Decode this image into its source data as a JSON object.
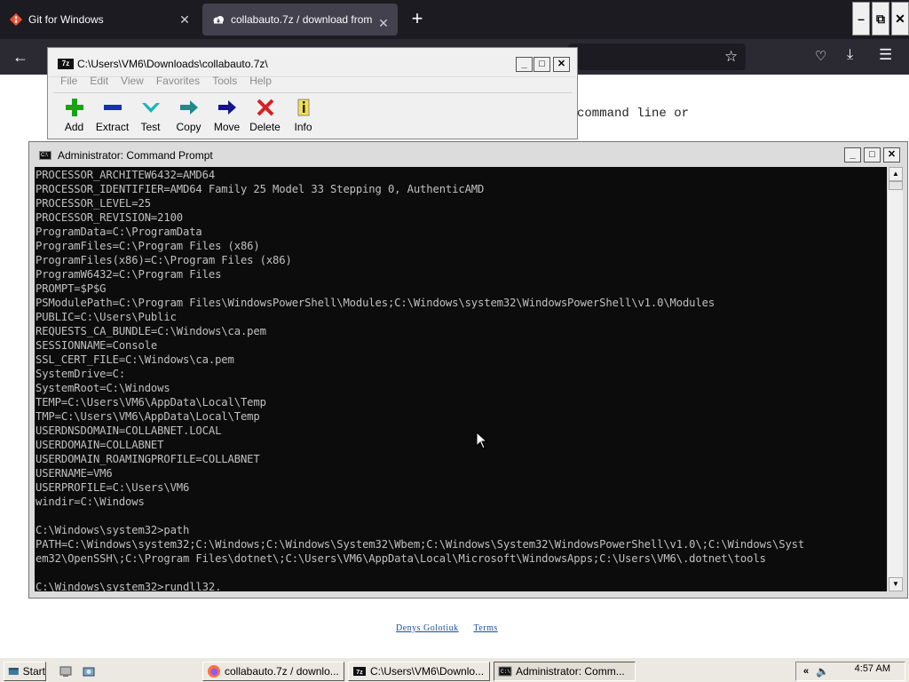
{
  "browser": {
    "tabs": [
      {
        "label": "Git for Windows"
      },
      {
        "label": "collabauto.7z / download from"
      }
    ],
    "colors": {
      "tabstrip": "#1c1b22",
      "active_tab": "#42414d",
      "navbar": "#2b2a33"
    }
  },
  "webpage": {
    "visible_text": "command line or",
    "footer_links": [
      "Denys Golotiuk",
      "Terms"
    ]
  },
  "zip_window": {
    "title": "C:\\Users\\VM6\\Downloads\\collabauto.7z\\",
    "app_icon_text": "7z",
    "menu": [
      "File",
      "Edit",
      "View",
      "Favorites",
      "Tools",
      "Help"
    ],
    "toolbar": [
      {
        "label": "Add",
        "icon": "plus-icon",
        "color": "#1aa31a"
      },
      {
        "label": "Extract",
        "icon": "minus-icon",
        "color": "#1a2fb8"
      },
      {
        "label": "Test",
        "icon": "check-icon",
        "color": "#18b6b6"
      },
      {
        "label": "Copy",
        "icon": "arrow-right-icon",
        "color": "#1f8a8a"
      },
      {
        "label": "Move",
        "icon": "arrow-right-icon",
        "color": "#14148c"
      },
      {
        "label": "Delete",
        "icon": "x-icon",
        "color": "#d81f1f"
      },
      {
        "label": "Info",
        "icon": "info-icon",
        "color": "#1e1e1e"
      }
    ]
  },
  "cmd_window": {
    "title": "Administrator: Command Prompt",
    "lines": [
      "PROCESSOR_ARCHITEW6432=AMD64",
      "PROCESSOR_IDENTIFIER=AMD64 Family 25 Model 33 Stepping 0, AuthenticAMD",
      "PROCESSOR_LEVEL=25",
      "PROCESSOR_REVISION=2100",
      "ProgramData=C:\\ProgramData",
      "ProgramFiles=C:\\Program Files (x86)",
      "ProgramFiles(x86)=C:\\Program Files (x86)",
      "ProgramW6432=C:\\Program Files",
      "PROMPT=$P$G",
      "PSModulePath=C:\\Program Files\\WindowsPowerShell\\Modules;C:\\Windows\\system32\\WindowsPowerShell\\v1.0\\Modules",
      "PUBLIC=C:\\Users\\Public",
      "REQUESTS_CA_BUNDLE=C:\\Windows\\ca.pem",
      "SESSIONNAME=Console",
      "SSL_CERT_FILE=C:\\Windows\\ca.pem",
      "SystemDrive=C:",
      "SystemRoot=C:\\Windows",
      "TEMP=C:\\Users\\VM6\\AppData\\Local\\Temp",
      "TMP=C:\\Users\\VM6\\AppData\\Local\\Temp",
      "USERDNSDOMAIN=COLLABNET.LOCAL",
      "USERDOMAIN=COLLABNET",
      "USERDOMAIN_ROAMINGPROFILE=COLLABNET",
      "USERNAME=VM6",
      "USERPROFILE=C:\\Users\\VM6",
      "windir=C:\\Windows",
      "",
      "C:\\Windows\\system32>path",
      "PATH=C:\\Windows\\system32;C:\\Windows;C:\\Windows\\System32\\Wbem;C:\\Windows\\System32\\WindowsPowerShell\\v1.0\\;C:\\Windows\\Syst",
      "em32\\OpenSSH\\;C:\\Program Files\\dotnet\\;C:\\Users\\VM6\\AppData\\Local\\Microsoft\\WindowsApps;C:\\Users\\VM6\\.dotnet\\tools",
      "",
      "C:\\Windows\\system32>rundll32."
    ],
    "colors": {
      "background": "#0c0c0c",
      "text": "#c0c0c0"
    }
  },
  "taskbar": {
    "start_label": "Start",
    "buttons": [
      {
        "label": "collabauto.7z / downlo...",
        "icon": "firefox-icon"
      },
      {
        "label": "C:\\Users\\VM6\\Downlo...",
        "icon": "7zip-icon"
      },
      {
        "label": "Administrator: Comm...",
        "icon": "cmd-icon"
      }
    ],
    "clock": "4:57 AM"
  }
}
